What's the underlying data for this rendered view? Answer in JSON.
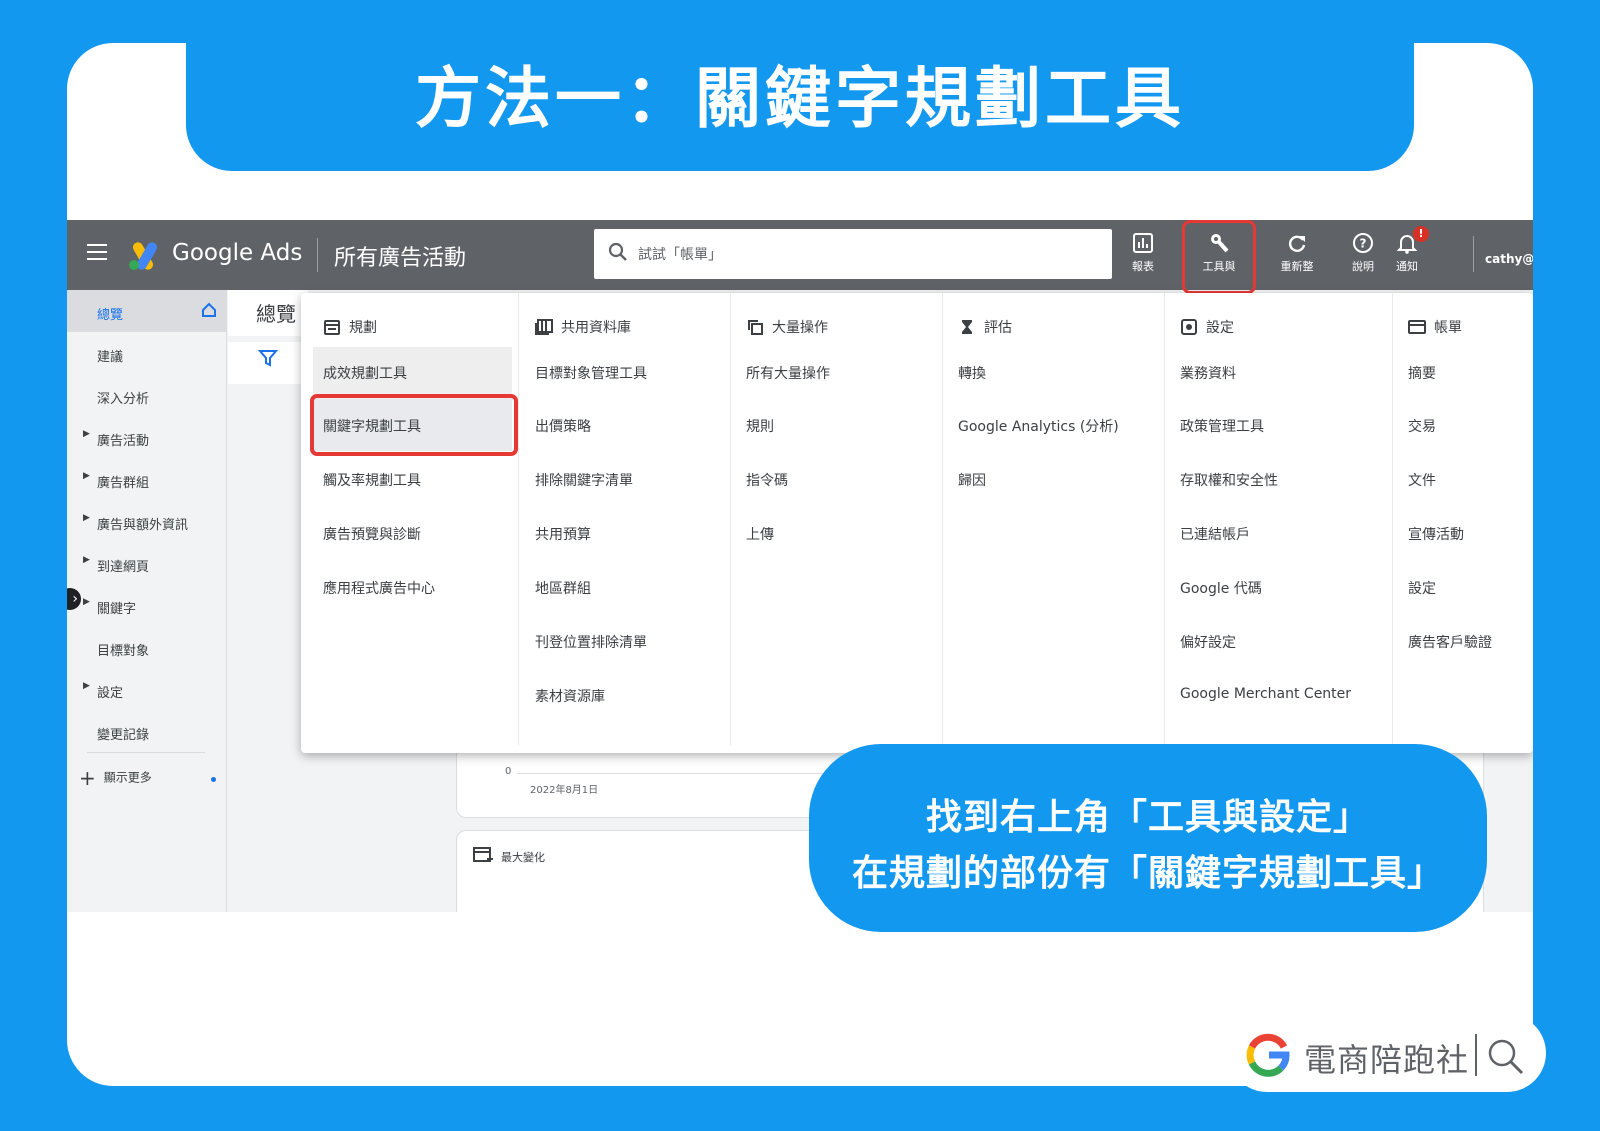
{
  "banner": {
    "title": "方法一：關鍵字規劃工具"
  },
  "topbar": {
    "brand": "Google Ads",
    "campaign_title": "所有廣告活動",
    "search_placeholder": "試試「帳單」",
    "buttons": [
      {
        "label": "報表",
        "icon": "bar-chart-icon"
      },
      {
        "label": "工具與",
        "icon": "wrench-icon"
      },
      {
        "label": "重新整",
        "icon": "refresh-icon"
      },
      {
        "label": "說明",
        "icon": "help-icon"
      },
      {
        "label": "通知",
        "icon": "bell-icon"
      }
    ],
    "notification_badge": "!",
    "user": "cathy@"
  },
  "sidebar": {
    "items": [
      {
        "label": "總覽",
        "expandable": false,
        "active": true
      },
      {
        "label": "建議",
        "expandable": false
      },
      {
        "label": "深入分析",
        "expandable": false
      },
      {
        "label": "廣告活動",
        "expandable": true
      },
      {
        "label": "廣告群組",
        "expandable": true
      },
      {
        "label": "廣告與額外資訊",
        "expandable": true
      },
      {
        "label": "到達網頁",
        "expandable": true
      },
      {
        "label": "關鍵字",
        "expandable": true
      },
      {
        "label": "目標對象",
        "expandable": false
      },
      {
        "label": "設定",
        "expandable": true
      },
      {
        "label": "變更記錄",
        "expandable": false
      }
    ],
    "show_more": "顯示更多"
  },
  "main": {
    "overview_tab": "總覽",
    "chart_zero": "0",
    "chart_date": "2022年8月1日",
    "biggest_change": "最大變化"
  },
  "dropdown": {
    "columns": [
      {
        "heading": "規劃",
        "icon": "calendar-icon",
        "items": [
          "成效規劃工具",
          "關鍵字規劃工具",
          "觸及率規劃工具",
          "廣告預覽與診斷",
          "應用程式廣告中心"
        ]
      },
      {
        "heading": "共用資料庫",
        "icon": "library-icon",
        "items": [
          "目標對象管理工具",
          "出價策略",
          "排除關鍵字清單",
          "共用預算",
          "地區群組",
          "刊登位置排除清單",
          "素材資源庫"
        ]
      },
      {
        "heading": "大量操作",
        "icon": "copy-icon",
        "items": [
          "所有大量操作",
          "規則",
          "指令碼",
          "上傳"
        ]
      },
      {
        "heading": "評估",
        "icon": "hourglass-icon",
        "items": [
          "轉換",
          "Google Analytics (分析)",
          "歸因"
        ]
      },
      {
        "heading": "設定",
        "icon": "settings-icon",
        "items": [
          "業務資料",
          "政策管理工具",
          "存取權和安全性",
          "已連結帳戶",
          "Google 代碼",
          "偏好設定",
          "Google Merchant Center"
        ]
      },
      {
        "heading": "帳單",
        "icon": "credit-card-icon",
        "items": [
          "摘要",
          "交易",
          "文件",
          "宣傳活動",
          "設定",
          "廣告客戶驗證"
        ]
      }
    ],
    "hovered_item": "成效規劃工具",
    "highlighted_item": "關鍵字規劃工具"
  },
  "callout": {
    "line1": "找到右上角「工具與設定」",
    "line2": "在規劃的部份有「關鍵字規劃工具」"
  },
  "watermark": {
    "text": "電商陪跑社"
  },
  "colors": {
    "background": "#1398f0",
    "highlight": "#e53935",
    "topbar": "#5f6368",
    "link": "#1a73e8"
  }
}
